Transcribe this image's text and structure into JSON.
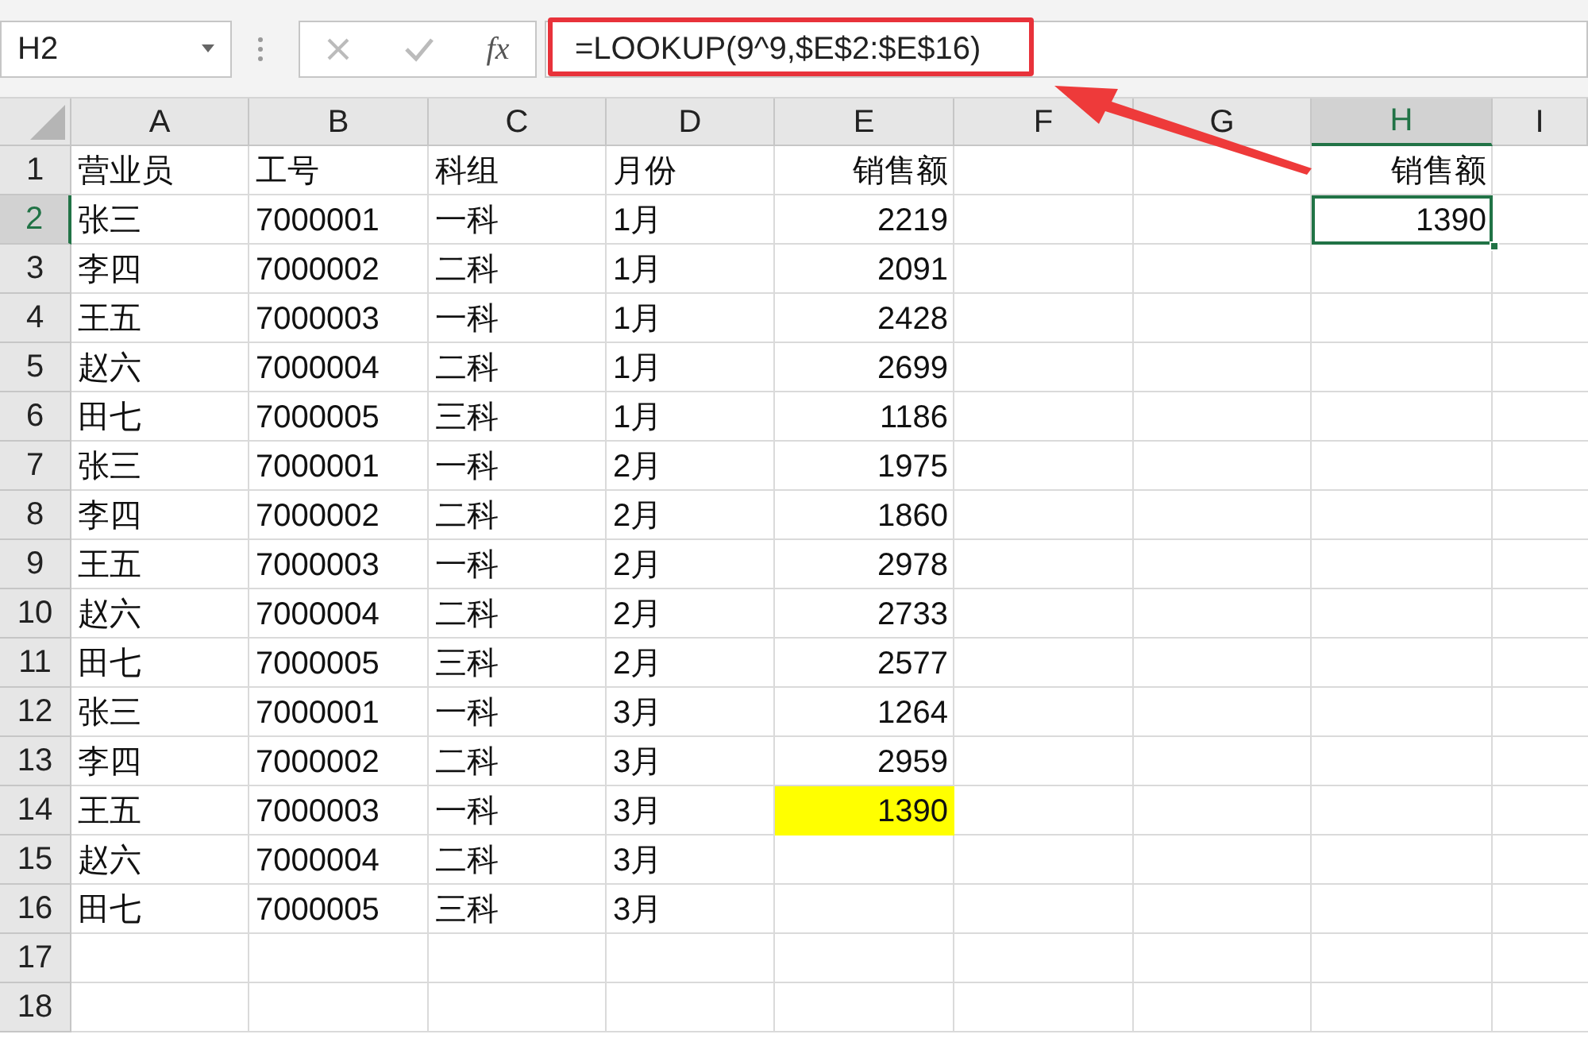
{
  "name_box": {
    "value": "H2"
  },
  "formula_bar": {
    "fx_label": "fx",
    "value": "=LOOKUP(9^9,$E$2:$E$16)"
  },
  "columns": [
    {
      "label": "A",
      "selected": false
    },
    {
      "label": "B",
      "selected": false
    },
    {
      "label": "C",
      "selected": false
    },
    {
      "label": "D",
      "selected": false
    },
    {
      "label": "E",
      "selected": false
    },
    {
      "label": "F",
      "selected": false
    },
    {
      "label": "G",
      "selected": false
    },
    {
      "label": "H",
      "selected": true
    },
    {
      "label": "I",
      "selected": false
    }
  ],
  "rows": [
    {
      "number": "1",
      "selected": false,
      "cells": [
        {
          "text": "营业员",
          "right_aligned": false,
          "selected": false
        },
        {
          "text": "工号",
          "right_aligned": false,
          "selected": false
        },
        {
          "text": "科组",
          "right_aligned": false,
          "selected": false
        },
        {
          "text": "月份",
          "right_aligned": false,
          "selected": false
        },
        {
          "text": "销售额",
          "right_aligned": true,
          "selected": false
        }
      ],
      "h_cell": {
        "text": "销售额",
        "right_aligned": true,
        "selected": false
      }
    },
    {
      "number": "2",
      "selected": true,
      "cells": [
        {
          "text": "张三",
          "right_aligned": false,
          "selected": false
        },
        {
          "text": "7000001",
          "right_aligned": false,
          "selected": false
        },
        {
          "text": "一科",
          "right_aligned": false,
          "selected": false
        },
        {
          "text": "1月",
          "right_aligned": false,
          "selected": false
        },
        {
          "text": "2219",
          "right_aligned": true,
          "selected": false
        }
      ],
      "h_cell": {
        "text": "1390",
        "right_aligned": true,
        "selected": true
      }
    },
    {
      "number": "3",
      "selected": false,
      "cells": [
        {
          "text": "李四",
          "right_aligned": false,
          "selected": false
        },
        {
          "text": "7000002",
          "right_aligned": false,
          "selected": false
        },
        {
          "text": "二科",
          "right_aligned": false,
          "selected": false
        },
        {
          "text": "1月",
          "right_aligned": false,
          "selected": false
        },
        {
          "text": "2091",
          "right_aligned": true,
          "selected": false
        }
      ]
    },
    {
      "number": "4",
      "selected": false,
      "cells": [
        {
          "text": "王五",
          "right_aligned": false,
          "selected": false
        },
        {
          "text": "7000003",
          "right_aligned": false,
          "selected": false
        },
        {
          "text": "一科",
          "right_aligned": false,
          "selected": false
        },
        {
          "text": "1月",
          "right_aligned": false,
          "selected": false
        },
        {
          "text": "2428",
          "right_aligned": true,
          "selected": false
        }
      ]
    },
    {
      "number": "5",
      "selected": false,
      "cells": [
        {
          "text": "赵六",
          "right_aligned": false,
          "selected": false
        },
        {
          "text": "7000004",
          "right_aligned": false,
          "selected": false
        },
        {
          "text": "二科",
          "right_aligned": false,
          "selected": false
        },
        {
          "text": "1月",
          "right_aligned": false,
          "selected": false
        },
        {
          "text": "2699",
          "right_aligned": true,
          "selected": false
        }
      ]
    },
    {
      "number": "6",
      "selected": false,
      "cells": [
        {
          "text": "田七",
          "right_aligned": false,
          "selected": false
        },
        {
          "text": "7000005",
          "right_aligned": false,
          "selected": false
        },
        {
          "text": "三科",
          "right_aligned": false,
          "selected": false
        },
        {
          "text": "1月",
          "right_aligned": false,
          "selected": false
        },
        {
          "text": "1186",
          "right_aligned": true,
          "selected": false
        }
      ]
    },
    {
      "number": "7",
      "selected": false,
      "cells": [
        {
          "text": "张三",
          "right_aligned": false,
          "selected": false
        },
        {
          "text": "7000001",
          "right_aligned": false,
          "selected": false
        },
        {
          "text": "一科",
          "right_aligned": false,
          "selected": false
        },
        {
          "text": "2月",
          "right_aligned": false,
          "selected": false
        },
        {
          "text": "1975",
          "right_aligned": true,
          "selected": false
        }
      ]
    },
    {
      "number": "8",
      "selected": false,
      "cells": [
        {
          "text": "李四",
          "right_aligned": false,
          "selected": false
        },
        {
          "text": "7000002",
          "right_aligned": false,
          "selected": false
        },
        {
          "text": "二科",
          "right_aligned": false,
          "selected": false
        },
        {
          "text": "2月",
          "right_aligned": false,
          "selected": false
        },
        {
          "text": "1860",
          "right_aligned": true,
          "selected": false
        }
      ]
    },
    {
      "number": "9",
      "selected": false,
      "cells": [
        {
          "text": "王五",
          "right_aligned": false,
          "selected": false
        },
        {
          "text": "7000003",
          "right_aligned": false,
          "selected": false
        },
        {
          "text": "一科",
          "right_aligned": false,
          "selected": false
        },
        {
          "text": "2月",
          "right_aligned": false,
          "selected": false
        },
        {
          "text": "2978",
          "right_aligned": true,
          "selected": false
        }
      ]
    },
    {
      "number": "10",
      "selected": false,
      "cells": [
        {
          "text": "赵六",
          "right_aligned": false,
          "selected": false
        },
        {
          "text": "7000004",
          "right_aligned": false,
          "selected": false
        },
        {
          "text": "二科",
          "right_aligned": false,
          "selected": false
        },
        {
          "text": "2月",
          "right_aligned": false,
          "selected": false
        },
        {
          "text": "2733",
          "right_aligned": true,
          "selected": false
        }
      ]
    },
    {
      "number": "11",
      "selected": false,
      "cells": [
        {
          "text": "田七",
          "right_aligned": false,
          "selected": false
        },
        {
          "text": "7000005",
          "right_aligned": false,
          "selected": false
        },
        {
          "text": "三科",
          "right_aligned": false,
          "selected": false
        },
        {
          "text": "2月",
          "right_aligned": false,
          "selected": false
        },
        {
          "text": "2577",
          "right_aligned": true,
          "selected": false
        }
      ]
    },
    {
      "number": "12",
      "selected": false,
      "cells": [
        {
          "text": "张三",
          "right_aligned": false,
          "selected": false
        },
        {
          "text": "7000001",
          "right_aligned": false,
          "selected": false
        },
        {
          "text": "一科",
          "right_aligned": false,
          "selected": false
        },
        {
          "text": "3月",
          "right_aligned": false,
          "selected": false
        },
        {
          "text": "1264",
          "right_aligned": true,
          "selected": false
        }
      ]
    },
    {
      "number": "13",
      "selected": false,
      "cells": [
        {
          "text": "李四",
          "right_aligned": false,
          "selected": false
        },
        {
          "text": "7000002",
          "right_aligned": false,
          "selected": false
        },
        {
          "text": "二科",
          "right_aligned": false,
          "selected": false
        },
        {
          "text": "3月",
          "right_aligned": false,
          "selected": false
        },
        {
          "text": "2959",
          "right_aligned": true,
          "selected": false
        }
      ]
    },
    {
      "number": "14",
      "selected": false,
      "cells": [
        {
          "text": "王五",
          "right_aligned": false,
          "selected": false
        },
        {
          "text": "7000003",
          "right_aligned": false,
          "selected": false
        },
        {
          "text": "一科",
          "right_aligned": false,
          "selected": false
        },
        {
          "text": "3月",
          "right_aligned": false,
          "selected": false
        },
        {
          "text": "1390",
          "right_aligned": true,
          "color": "#ffff00",
          "selected": false
        }
      ]
    },
    {
      "number": "15",
      "selected": false,
      "cells": [
        {
          "text": "赵六",
          "right_aligned": false,
          "selected": false
        },
        {
          "text": "7000004",
          "right_aligned": false,
          "selected": false
        },
        {
          "text": "二科",
          "right_aligned": false,
          "selected": false
        },
        {
          "text": "3月",
          "right_aligned": false,
          "selected": false
        }
      ]
    },
    {
      "number": "16",
      "selected": false,
      "cells": [
        {
          "text": "田七",
          "right_aligned": false,
          "selected": false
        },
        {
          "text": "7000005",
          "right_aligned": false,
          "selected": false
        },
        {
          "text": "三科",
          "right_aligned": false,
          "selected": false
        },
        {
          "text": "3月",
          "right_aligned": false,
          "selected": false
        }
      ]
    },
    {
      "number": "17",
      "selected": false
    },
    {
      "number": "18",
      "selected": false
    }
  ]
}
